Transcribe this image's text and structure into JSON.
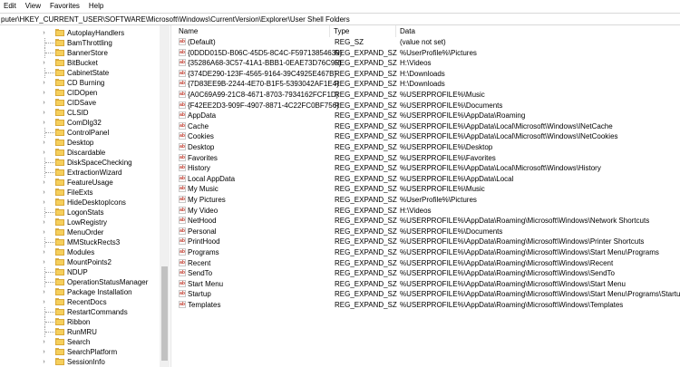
{
  "menu": [
    "Edit",
    "View",
    "Favorites",
    "Help"
  ],
  "address": "puter\\HKEY_CURRENT_USER\\SOFTWARE\\Microsoft\\Windows\\CurrentVersion\\Explorer\\User Shell Folders",
  "tree": [
    {
      "label": "AutoplayHandlers",
      "expandable": true
    },
    {
      "label": "BamThrottling",
      "expandable": false
    },
    {
      "label": "BannerStore",
      "expandable": false
    },
    {
      "label": "BitBucket",
      "expandable": true
    },
    {
      "label": "CabinetState",
      "expandable": false
    },
    {
      "label": "CD Burning",
      "expandable": true
    },
    {
      "label": "CIDOpen",
      "expandable": true
    },
    {
      "label": "CIDSave",
      "expandable": true
    },
    {
      "label": "CLSID",
      "expandable": true
    },
    {
      "label": "ComDlg32",
      "expandable": true
    },
    {
      "label": "ControlPanel",
      "expandable": false
    },
    {
      "label": "Desktop",
      "expandable": true
    },
    {
      "label": "Discardable",
      "expandable": true
    },
    {
      "label": "DiskSpaceChecking",
      "expandable": false
    },
    {
      "label": "ExtractionWizard",
      "expandable": false
    },
    {
      "label": "FeatureUsage",
      "expandable": true
    },
    {
      "label": "FileExts",
      "expandable": true
    },
    {
      "label": "HideDesktopIcons",
      "expandable": true
    },
    {
      "label": "LogonStats",
      "expandable": false
    },
    {
      "label": "LowRegistry",
      "expandable": true
    },
    {
      "label": "MenuOrder",
      "expandable": true
    },
    {
      "label": "MMStuckRects3",
      "expandable": false
    },
    {
      "label": "Modules",
      "expandable": true
    },
    {
      "label": "MountPoints2",
      "expandable": true
    },
    {
      "label": "NDUP",
      "expandable": false
    },
    {
      "label": "OperationStatusManager",
      "expandable": false
    },
    {
      "label": "Package Installation",
      "expandable": true
    },
    {
      "label": "RecentDocs",
      "expandable": true
    },
    {
      "label": "RestartCommands",
      "expandable": false
    },
    {
      "label": "Ribbon",
      "expandable": false
    },
    {
      "label": "RunMRU",
      "expandable": false
    },
    {
      "label": "Search",
      "expandable": true
    },
    {
      "label": "SearchPlatform",
      "expandable": true
    },
    {
      "label": "SessionInfo",
      "expandable": true
    }
  ],
  "columns": {
    "name": "Name",
    "type": "Type",
    "data": "Data"
  },
  "values": [
    {
      "name": "(Default)",
      "type": "REG_SZ",
      "data": "(value not set)"
    },
    {
      "name": "{0DDD015D-B06C-45D5-8C4C-F59713854639}",
      "type": "REG_EXPAND_SZ",
      "data": "%UserProfile%\\Pictures"
    },
    {
      "name": "{35286A68-3C57-41A1-BBB1-0EAE73D76C95}",
      "type": "REG_EXPAND_SZ",
      "data": "H:\\Videos"
    },
    {
      "name": "{374DE290-123F-4565-9164-39C4925E467B}",
      "type": "REG_EXPAND_SZ",
      "data": "H:\\Downloads"
    },
    {
      "name": "{7D83EE9B-2244-4E70-B1F5-5393042AF1E4}",
      "type": "REG_EXPAND_SZ",
      "data": "H:\\Downloads"
    },
    {
      "name": "{A0C69A99-21C8-4671-8703-7934162FCF1D}",
      "type": "REG_EXPAND_SZ",
      "data": "%USERPROFILE%\\Music"
    },
    {
      "name": "{F42EE2D3-909F-4907-8871-4C22FC0BF756}",
      "type": "REG_EXPAND_SZ",
      "data": "%USERPROFILE%\\Documents"
    },
    {
      "name": "AppData",
      "type": "REG_EXPAND_SZ",
      "data": "%USERPROFILE%\\AppData\\Roaming"
    },
    {
      "name": "Cache",
      "type": "REG_EXPAND_SZ",
      "data": "%USERPROFILE%\\AppData\\Local\\Microsoft\\Windows\\INetCache"
    },
    {
      "name": "Cookies",
      "type": "REG_EXPAND_SZ",
      "data": "%USERPROFILE%\\AppData\\Local\\Microsoft\\Windows\\INetCookies"
    },
    {
      "name": "Desktop",
      "type": "REG_EXPAND_SZ",
      "data": "%USERPROFILE%\\Desktop"
    },
    {
      "name": "Favorites",
      "type": "REG_EXPAND_SZ",
      "data": "%USERPROFILE%\\Favorites"
    },
    {
      "name": "History",
      "type": "REG_EXPAND_SZ",
      "data": "%USERPROFILE%\\AppData\\Local\\Microsoft\\Windows\\History"
    },
    {
      "name": "Local AppData",
      "type": "REG_EXPAND_SZ",
      "data": "%USERPROFILE%\\AppData\\Local"
    },
    {
      "name": "My Music",
      "type": "REG_EXPAND_SZ",
      "data": "%USERPROFILE%\\Music"
    },
    {
      "name": "My Pictures",
      "type": "REG_EXPAND_SZ",
      "data": "%UserProfile%\\Pictures"
    },
    {
      "name": "My Video",
      "type": "REG_EXPAND_SZ",
      "data": "H:\\Videos"
    },
    {
      "name": "NetHood",
      "type": "REG_EXPAND_SZ",
      "data": "%USERPROFILE%\\AppData\\Roaming\\Microsoft\\Windows\\Network Shortcuts"
    },
    {
      "name": "Personal",
      "type": "REG_EXPAND_SZ",
      "data": "%USERPROFILE%\\Documents"
    },
    {
      "name": "PrintHood",
      "type": "REG_EXPAND_SZ",
      "data": "%USERPROFILE%\\AppData\\Roaming\\Microsoft\\Windows\\Printer Shortcuts"
    },
    {
      "name": "Programs",
      "type": "REG_EXPAND_SZ",
      "data": "%USERPROFILE%\\AppData\\Roaming\\Microsoft\\Windows\\Start Menu\\Programs"
    },
    {
      "name": "Recent",
      "type": "REG_EXPAND_SZ",
      "data": "%USERPROFILE%\\AppData\\Roaming\\Microsoft\\Windows\\Recent"
    },
    {
      "name": "SendTo",
      "type": "REG_EXPAND_SZ",
      "data": "%USERPROFILE%\\AppData\\Roaming\\Microsoft\\Windows\\SendTo"
    },
    {
      "name": "Start Menu",
      "type": "REG_EXPAND_SZ",
      "data": "%USERPROFILE%\\AppData\\Roaming\\Microsoft\\Windows\\Start Menu"
    },
    {
      "name": "Startup",
      "type": "REG_EXPAND_SZ",
      "data": "%USERPROFILE%\\AppData\\Roaming\\Microsoft\\Windows\\Start Menu\\Programs\\Startup"
    },
    {
      "name": "Templates",
      "type": "REG_EXPAND_SZ",
      "data": "%USERPROFILE%\\AppData\\Roaming\\Microsoft\\Windows\\Templates"
    }
  ],
  "value_icon_text": "ab"
}
